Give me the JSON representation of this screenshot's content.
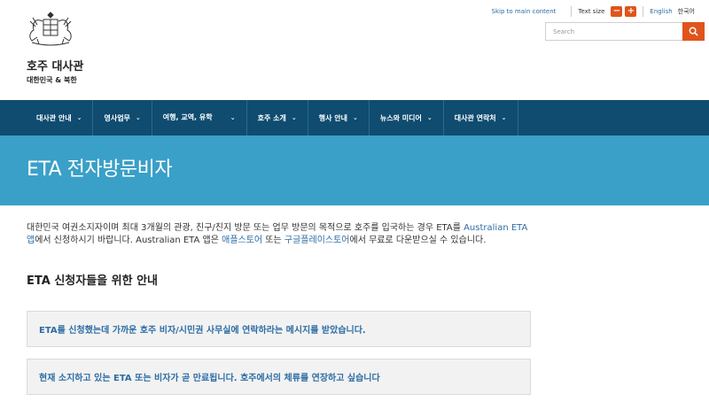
{
  "header": {
    "site_title": "호주 대사관",
    "site_subtitle": "대한민국 & 북한",
    "skip_link": "Skip to main content",
    "text_size_label": "Text size",
    "text_size_decrease": "−",
    "text_size_increase": "+",
    "lang_english": "English",
    "lang_korean": "한국어",
    "search_placeholder": "Search"
  },
  "nav": {
    "items": [
      {
        "label": "대사관 안내"
      },
      {
        "label": "영사업무"
      },
      {
        "label": "여행, 교역, 유학"
      },
      {
        "label": "호주 소개"
      },
      {
        "label": "행사 안내"
      },
      {
        "label": "뉴스와 미디어"
      },
      {
        "label": "대사관 연락처"
      }
    ]
  },
  "banner": {
    "title": "ETA 전자방문비자"
  },
  "intro": {
    "text1": "대한민국 여권소지자이며 최대 3개월의 관광, 친구/친지 방문 또는 업무 방문의 목적으로 호주를 입국하는 경우 ETA를 ",
    "link_app": "Australian ETA 앱",
    "text2": "에서 신청하시기 바랍니다. Australian ETA 앱은 ",
    "link_appstore": "애플스토어",
    "text3": " 또는 ",
    "link_playstore": "구글플레이스토어",
    "text4": "에서 무료로 다운받으실 수 있습니다."
  },
  "section_title": "ETA 신청자들을 위한 안내",
  "accordions": [
    {
      "label": "ETA를 신청했는데 가까운 호주 비자/시민권 사무실에 연락하라는 메시지를 받았습니다."
    },
    {
      "label": "현재 소지하고 있는 ETA 또는 비자가 곧 만료됩니다. 호주에서의 체류를 연장하고 싶습니다"
    }
  ],
  "colors": {
    "nav_bg": "#0f4c70",
    "banner_bg": "#3aa0c8",
    "accent_orange": "#e0541b",
    "link_blue": "#2e6da4"
  }
}
